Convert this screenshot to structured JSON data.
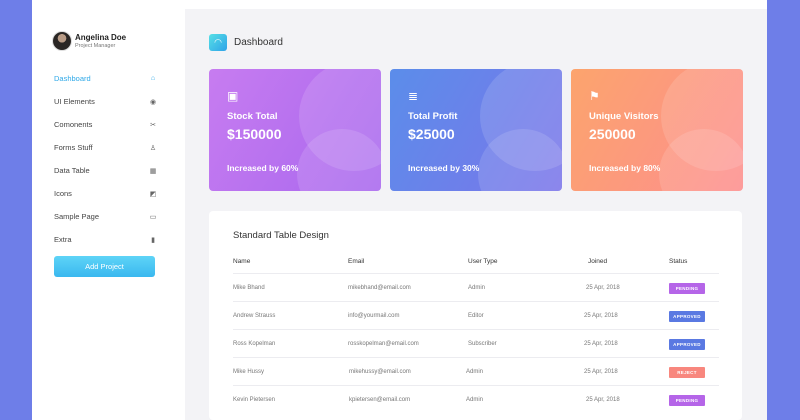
{
  "colors": {
    "accent": "#2fa9e8",
    "pending": "#b565e8",
    "approved": "#5a79e2",
    "reject": "#f8877e"
  },
  "profile": {
    "name": "Angelina Doe",
    "role": "Project Manager"
  },
  "sidebar": {
    "items": [
      {
        "label": "Dashboard",
        "icon": "home-icon",
        "glyph": "⌂"
      },
      {
        "label": "UI Elements",
        "icon": "palette-icon",
        "glyph": "◉"
      },
      {
        "label": "Comonents",
        "icon": "puzzle-icon",
        "glyph": "✂"
      },
      {
        "label": "Forms Stuff",
        "icon": "flask-icon",
        "glyph": "♙"
      },
      {
        "label": "Data Table",
        "icon": "table-icon",
        "glyph": "▦"
      },
      {
        "label": "Icons",
        "icon": "image-icon",
        "glyph": "◩"
      },
      {
        "label": "Sample Page",
        "icon": "monitor-icon",
        "glyph": "▭"
      },
      {
        "label": "Extra",
        "icon": "trash-icon",
        "glyph": "▮"
      }
    ],
    "add_button": "Add Project"
  },
  "header": {
    "title": "Dashboard",
    "icon": "gauge-icon",
    "glyph": "◠"
  },
  "cards": [
    {
      "label": "Stock Total",
      "value": "$150000",
      "sub": "Increased by 60%",
      "icon": "chart-window-icon",
      "glyph": "▣"
    },
    {
      "label": "Total Profit",
      "value": "$25000",
      "sub": "Increased by 30%",
      "icon": "database-icon",
      "glyph": "≣"
    },
    {
      "label": "Unique Visitors",
      "value": "250000",
      "sub": "Increased by 80%",
      "icon": "flag-icon",
      "glyph": "⚑"
    }
  ],
  "table": {
    "title": "Standard Table Design",
    "headers": [
      "Name",
      "Email",
      "User Type",
      "Joined",
      "Status"
    ],
    "rows": [
      {
        "name": "Mike Bhand",
        "email": "mikebhand@email.com",
        "type": "Admin",
        "joined": "25 Apr, 2018",
        "status": "PENDING",
        "kind": "pending"
      },
      {
        "name": "Andrew Strauss",
        "email": "info@yourmail.com",
        "type": "Editor",
        "joined": "25 Apr, 2018",
        "status": "APPROVED",
        "kind": "approved"
      },
      {
        "name": "Ross Kopelman",
        "email": "rosskopelman@email.com",
        "type": "Subscriber",
        "joined": "25 Apr, 2018",
        "status": "APPROVED",
        "kind": "approved"
      },
      {
        "name": "Mike Hussy",
        "email": "mikehussy@email.com",
        "type": "Admin",
        "joined": "25 Apr, 2018",
        "status": "REJECT",
        "kind": "reject"
      },
      {
        "name": "Kevin Pietersen",
        "email": "kpietersen@email.com",
        "type": "Admin",
        "joined": "25 Apr, 2018",
        "status": "PENDING",
        "kind": "pending"
      }
    ]
  }
}
